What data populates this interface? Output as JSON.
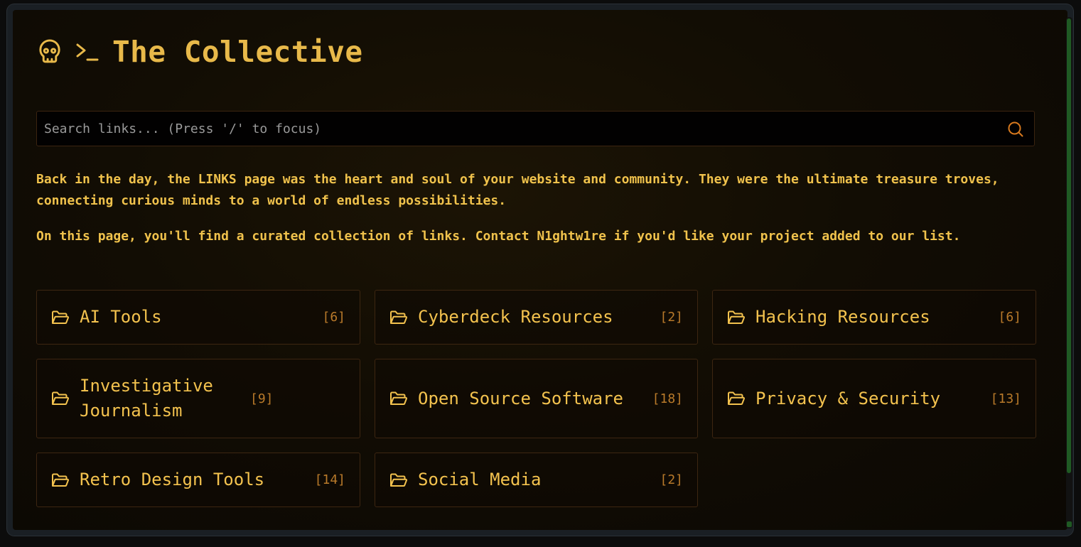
{
  "header": {
    "title": "The Collective",
    "skull_icon": "skull-icon",
    "prompt_icon": "terminal-prompt-icon"
  },
  "search": {
    "placeholder": "Search links... (Press '/' to focus)",
    "value": "",
    "icon": "search-icon"
  },
  "intro": {
    "paragraph1": "Back in the day, the LINKS page was the heart and soul of your website and community. They were the ultimate treasure troves, connecting curious minds to a world of endless possibilities.",
    "paragraph2": "On this page, you'll find a curated collection of links. Contact N1ghtw1re if you'd like your project added to our list."
  },
  "categories": [
    {
      "label": "AI Tools",
      "count": "[6]"
    },
    {
      "label": "Cyberdeck Resources",
      "count": "[2]"
    },
    {
      "label": "Hacking Resources",
      "count": "[6]"
    },
    {
      "label": "Investigative Journalism",
      "count": "[9]"
    },
    {
      "label": "Open Source Software",
      "count": "[18]"
    },
    {
      "label": "Privacy & Security",
      "count": "[13]"
    },
    {
      "label": "Retro Design Tools",
      "count": "[14]"
    },
    {
      "label": "Social Media",
      "count": "[2]"
    }
  ],
  "colors": {
    "accent": "#e8b94a",
    "text": "#f0c24c",
    "count": "#b97a2a",
    "search_icon": "#d97a1e",
    "scrollbar": "#1f5a23",
    "border": "#3d2611"
  }
}
